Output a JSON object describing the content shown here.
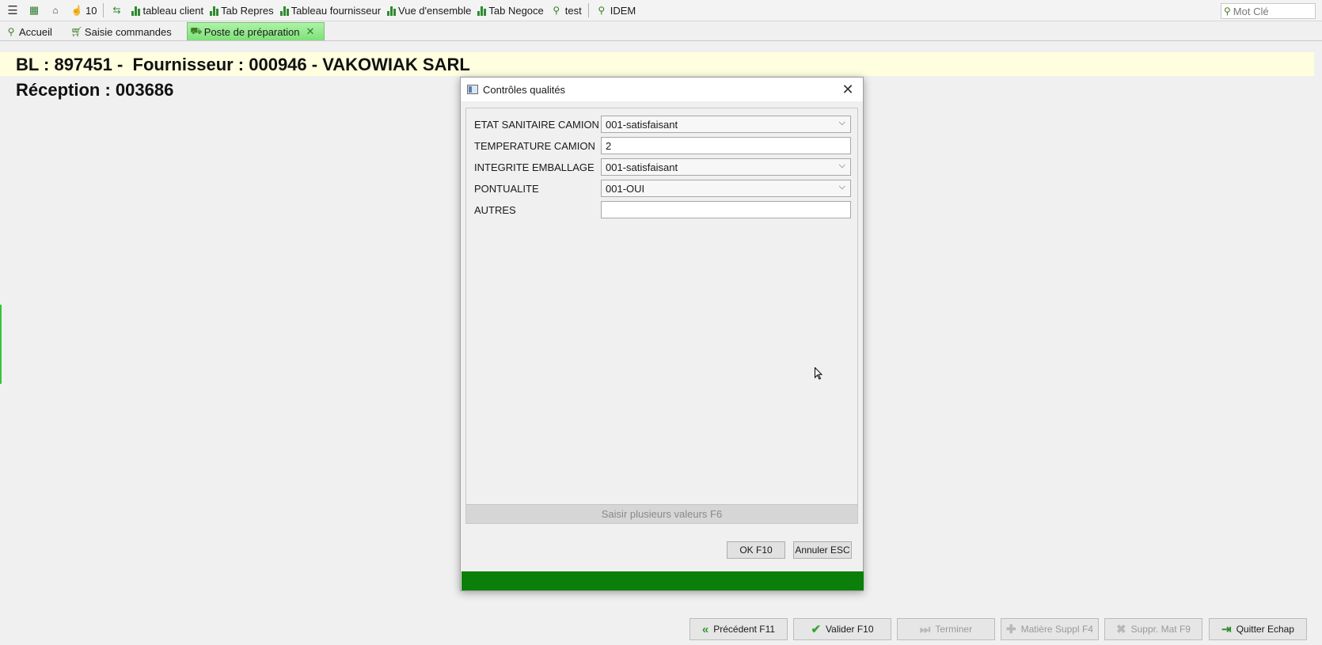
{
  "toolbar": {
    "count": "10",
    "items": [
      "tableau client",
      "Tab Repres",
      "Tableau fournisseur",
      "Vue d'ensemble",
      "Tab Negoce",
      "test",
      "IDEM"
    ],
    "search_placeholder": "Mot Clé"
  },
  "tabs": [
    {
      "label": "Accueil",
      "icon": "link-icon"
    },
    {
      "label": "Saisie commandes",
      "icon": "cart-icon"
    },
    {
      "label": "Poste de préparation",
      "icon": "forklift-icon",
      "active": true
    }
  ],
  "header": {
    "line1": "BL : 897451 -  Fournisseur : 000946 - VAKOWIAK SARL",
    "line2": "Réception : 003686"
  },
  "dialog": {
    "title": "Contrôles qualités",
    "fields": [
      {
        "label": "ETAT SANITAIRE CAMION",
        "value": "001-satisfaisant",
        "type": "select"
      },
      {
        "label": "TEMPERATURE CAMION",
        "value": "2",
        "type": "input"
      },
      {
        "label": "INTEGRITE EMBALLAGE",
        "value": "001-satisfaisant",
        "type": "select"
      },
      {
        "label": "PONTUALITE",
        "value": "001-OUI",
        "type": "select"
      },
      {
        "label": "AUTRES",
        "value": "",
        "type": "input"
      }
    ],
    "multi_values_label": "Saisir plusieurs valeurs F6",
    "ok_label": "OK F10",
    "cancel_label": "Annuler ESC",
    "status_color": "#0a7f0a"
  },
  "bottom_buttons": [
    {
      "label": "Précédent F11",
      "enabled": true
    },
    {
      "label": "Valider F10",
      "enabled": true
    },
    {
      "label": "Terminer",
      "enabled": false
    },
    {
      "label": "Matière Suppl F4",
      "enabled": false
    },
    {
      "label": "Suppr. Mat F9",
      "enabled": false
    },
    {
      "label": "Quitter Echap",
      "enabled": true
    }
  ]
}
